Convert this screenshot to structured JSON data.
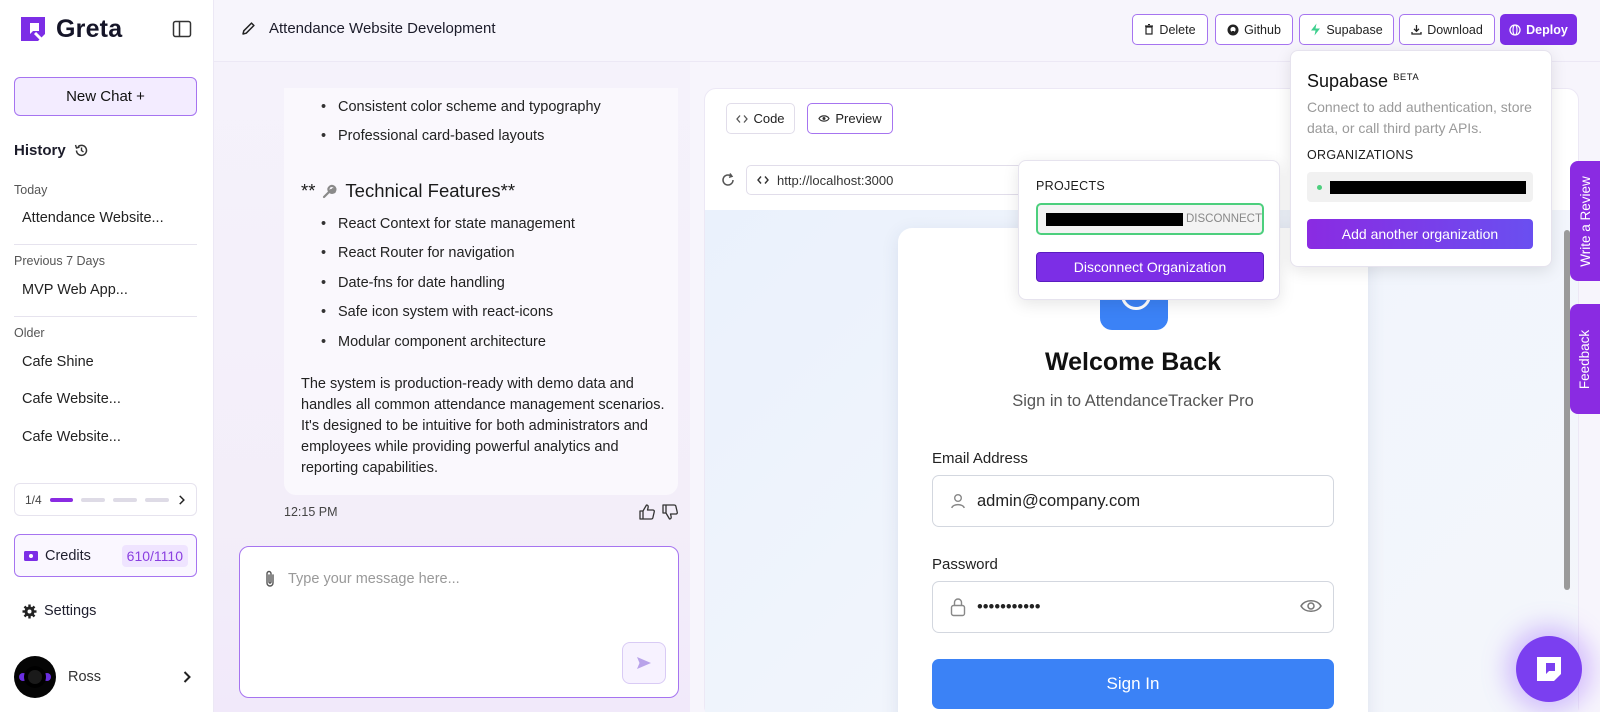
{
  "app": {
    "name": "Greta",
    "brand_color": "#7c2ee6"
  },
  "sidebar": {
    "new_chat": "New Chat +",
    "history_title": "History",
    "groups": [
      {
        "label": "Today",
        "items": [
          "Attendance Website..."
        ]
      },
      {
        "label": "Previous 7 Days",
        "items": [
          "MVP Web App..."
        ]
      },
      {
        "label": "Older",
        "items": [
          "Cafe Shine",
          "Cafe Website...",
          "Cafe Website..."
        ]
      }
    ],
    "pager": {
      "label": "1/4",
      "current_step": 1,
      "total_steps": 4
    },
    "credits": {
      "label": "Credits",
      "value": "610/1110"
    },
    "settings": "Settings",
    "user_name": "Ross"
  },
  "topbar": {
    "project_title": "Attendance Website Development",
    "buttons": {
      "delete": "Delete",
      "github": "Github",
      "supabase": "Supabase",
      "download": "Download",
      "deploy": "Deploy"
    }
  },
  "chat": {
    "design_bullets": [
      "Consistent color scheme and typography",
      "Professional card-based layouts"
    ],
    "tech_heading_prefix": "**",
    "tech_heading": "Technical Features**",
    "tech_bullets": [
      "React Context for state management",
      "React Router for navigation",
      "Date-fns for date handling",
      "Safe icon system with react-icons",
      "Modular component architecture"
    ],
    "paragraph": "The system is production-ready with demo data and handles all common attendance management scenarios. It's designed to be intuitive for both administrators and employees while providing powerful analytics and reporting capabilities.",
    "timestamp": "12:15 PM",
    "composer_placeholder": "Type your message here..."
  },
  "preview": {
    "tabs": {
      "code": "Code",
      "preview": "Preview"
    },
    "url": "http://localhost:3000",
    "login": {
      "title": "Welcome Back",
      "subtitle": "Sign in to AttendanceTracker Pro",
      "email_label": "Email Address",
      "email_value": "admin@company.com",
      "password_label": "Password",
      "password_value": "•••••••••••",
      "submit": "Sign In"
    }
  },
  "projects_popover": {
    "label": "PROJECTS",
    "disconnect_inline": "DISCONNECT",
    "disconnect_button": "Disconnect Organization"
  },
  "supabase_popover": {
    "title": "Supabase",
    "badge": "BETA",
    "description": "Connect to add authentication, store data, or call third party APIs.",
    "org_label": "ORGANIZATIONS",
    "add_button": "Add another organization"
  },
  "side_tabs": {
    "review": "Write a Review",
    "feedback": "Feedback"
  }
}
